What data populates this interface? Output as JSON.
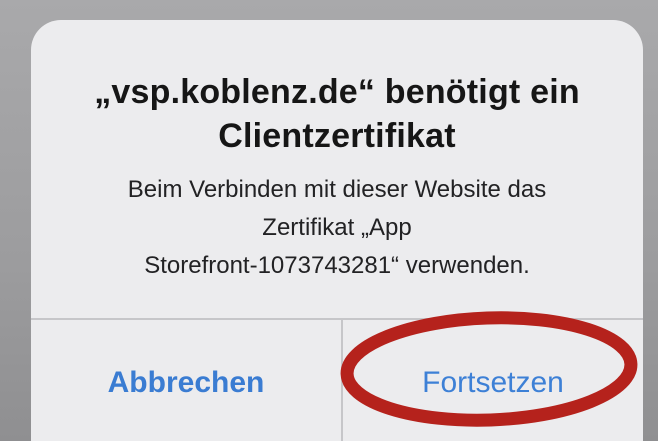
{
  "alert": {
    "title_lines": [
      "„vsp.koblenz.de“ benötigt ein",
      "Clientzertifikat"
    ],
    "message_lines": [
      "Beim Verbinden mit dieser Website das",
      "Zertifikat „App",
      "Storefront-1073743281“ verwenden."
    ],
    "cancel_label": "Abbrechen",
    "continue_label": "Fortsetzen"
  },
  "colors": {
    "button_text": "#3a7cd2",
    "annotation_circle": "#b5221c",
    "alert_background": "#ececee"
  },
  "icons": {
    "annotation": "red-ellipse-highlight"
  }
}
